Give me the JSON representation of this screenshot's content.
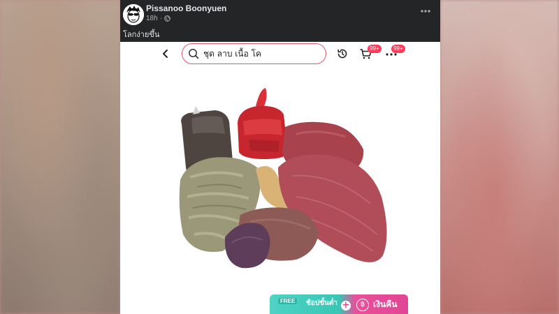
{
  "post": {
    "author": "Pissanoo Boonyuen",
    "time": "18h",
    "privacy_icon": "globe-icon",
    "caption": "โลกง่ายขึ้น",
    "menu_icon": "more-horizontal-icon"
  },
  "app": {
    "search": {
      "value": "ชุด ลาบ เนื้อ โค",
      "icon": "search-icon"
    },
    "back_icon": "chevron-left-icon",
    "history_icon": "history-icon",
    "cart_icon": "cart-icon",
    "cart_badge": "99+",
    "more_icon": "more-horizontal-icon",
    "more_badge": "99+",
    "product_image": "beef-larb-set-photo",
    "promo": {
      "free_label": "FREE",
      "condition": "ช้อปขั้นต่ำ",
      "cashback": "เงินคืน",
      "coin_icon": "baht-coin-icon"
    }
  },
  "colors": {
    "post_header_bg": "#242526",
    "search_border": "#e2556a",
    "badge": "#ff3b5c",
    "promo_teal": "#38c6b5",
    "promo_pink": "#e14595"
  }
}
